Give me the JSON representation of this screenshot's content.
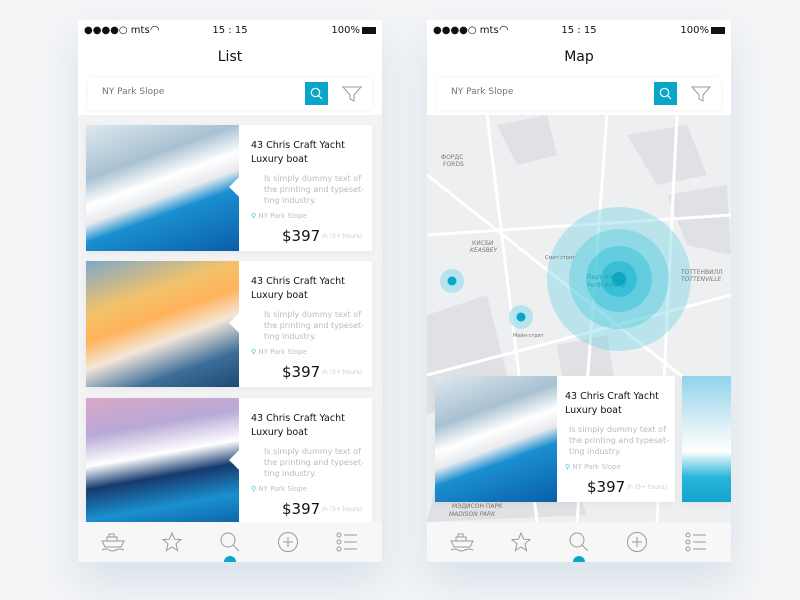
{
  "status": {
    "carrier": "●●●●○ mts",
    "time": "15 : 15",
    "battery": "100%"
  },
  "list_screen": {
    "title": "List",
    "search_placeholder": "NY Park Slope",
    "cards": [
      {
        "name": "43 Chris Craft Yacht Luxury boat",
        "desc": "Is simply dummy text of the printing and typeset-ting  industry.",
        "location": "NY Park Slope",
        "price": "$397",
        "price_suffix": "/h (5+ hours)"
      },
      {
        "name": "43 Chris Craft Yacht Luxury boat",
        "desc": "Is simply dummy text of the printing and typeset-ting  industry.",
        "location": "NY Park Slope",
        "price": "$397",
        "price_suffix": "/h (5+ hours)"
      },
      {
        "name": "43 Chris Craft Yacht Luxury boat",
        "desc": "Is simply dummy text of the printing and typeset-ting  industry.",
        "location": "NY Park Slope",
        "price": "$397",
        "price_suffix": "/h (5+ hours)"
      }
    ]
  },
  "map_screen": {
    "title": "Map",
    "search_placeholder": "NY Park Slope",
    "labels": {
      "fords_ru": "ФОРДС",
      "fords": "FORDS",
      "keasbey_ru": "КИСБИ",
      "keasbey": "KEASBEY",
      "perth_ru": "Перт Амбой",
      "perth": "Perth Amboy",
      "tott_ru": "ТОТТЕНВИЛЛ",
      "tott": "TOTTENVILLE",
      "madison_ru": "МЭДИСОН ПАРК",
      "madison": "MADISON PARK",
      "smith": "Смит-стрит",
      "main": "Мейн-стрит"
    },
    "card": {
      "name": "43 Chris Craft Yacht Luxury boat",
      "desc": "Is simply dummy text of the printing and typeset-ting  industry.",
      "location": "NY Park Slope",
      "price": "$397",
      "price_suffix": "/h (5+ hours)"
    }
  },
  "tabs": [
    {
      "icon": "boat-icon"
    },
    {
      "icon": "star-icon"
    },
    {
      "icon": "search-icon",
      "active": true
    },
    {
      "icon": "plus-circle-icon"
    },
    {
      "icon": "list-icon"
    }
  ],
  "colors": {
    "accent": "#0aa6c9"
  }
}
